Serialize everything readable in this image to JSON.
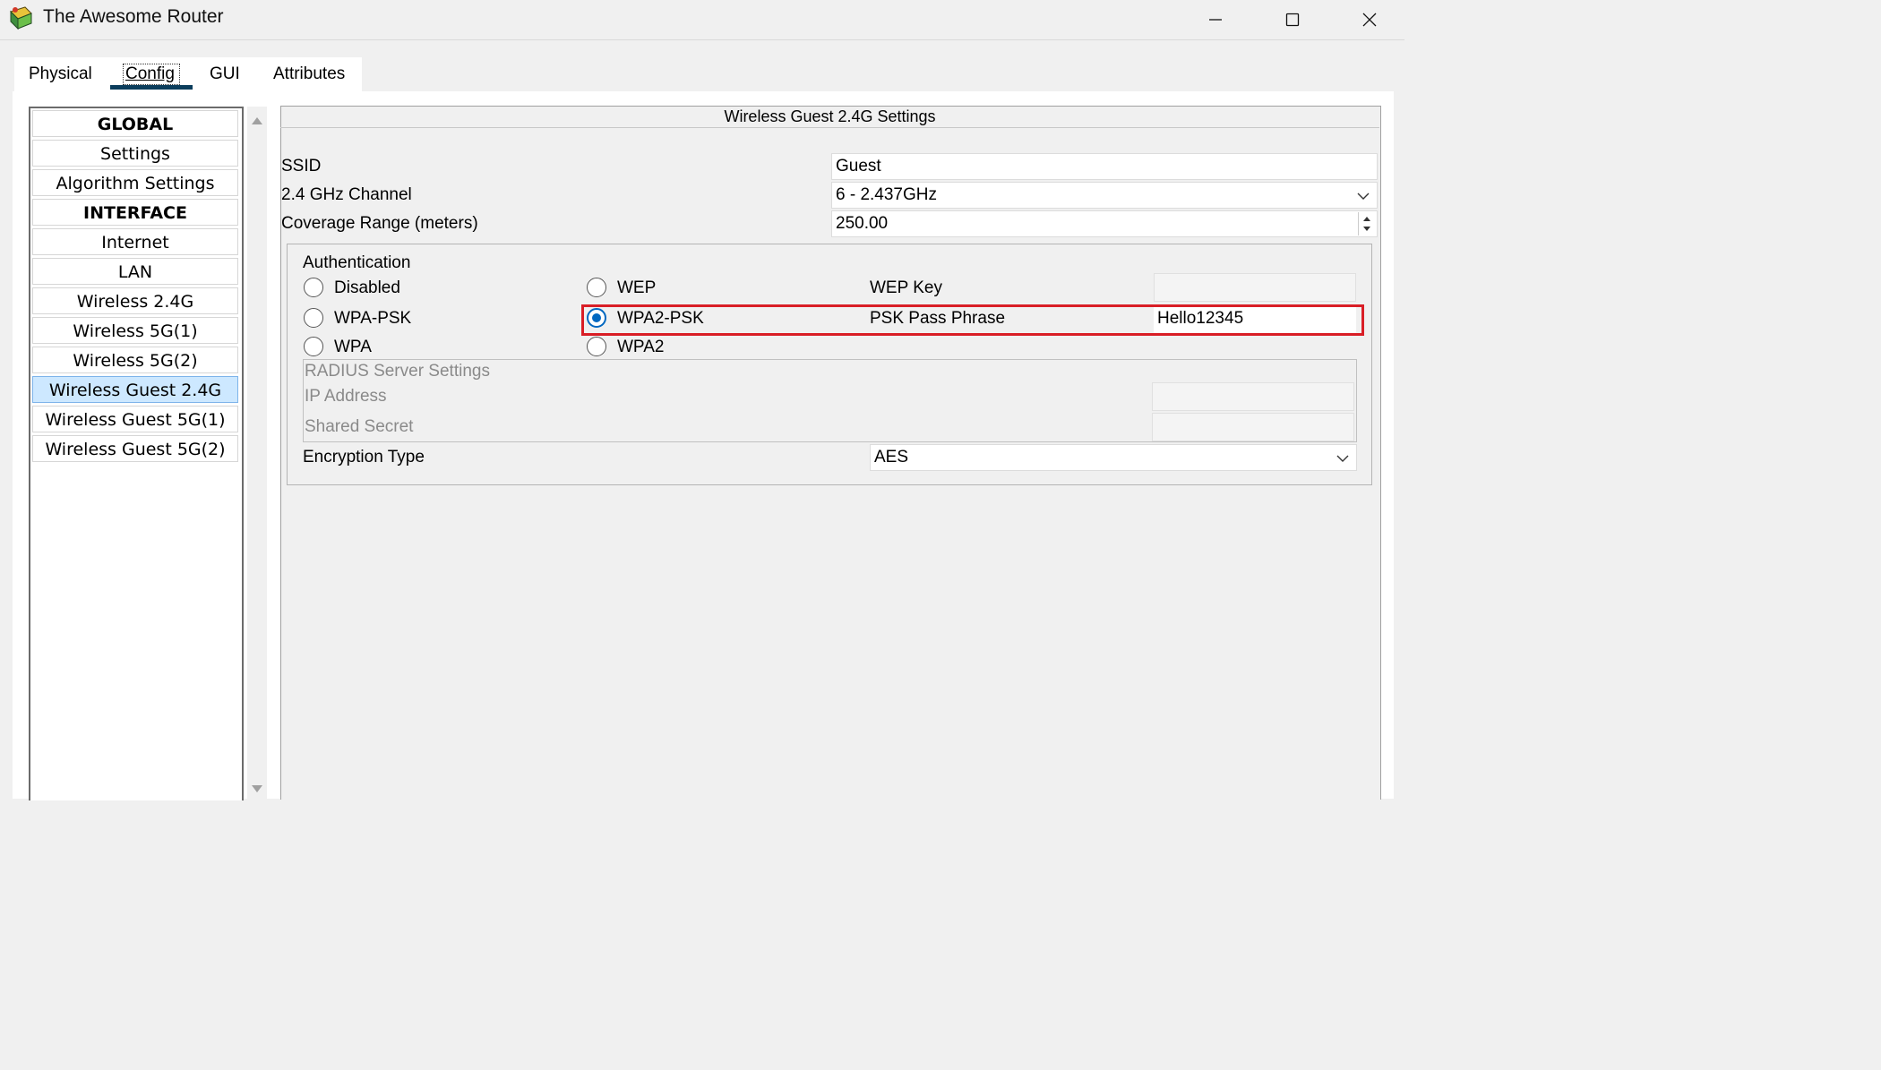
{
  "window": {
    "title": "The Awesome Router",
    "icons": {
      "app": "router-app-icon",
      "minimize": "minimize-icon",
      "maximize": "maximize-icon",
      "close": "close-icon"
    }
  },
  "tabs": [
    {
      "label": "Physical",
      "active": false
    },
    {
      "label": "Config",
      "active": true
    },
    {
      "label": "GUI",
      "active": false
    },
    {
      "label": "Attributes",
      "active": false
    }
  ],
  "sidebar": {
    "items": [
      {
        "label": "GLOBAL",
        "header": true
      },
      {
        "label": "Settings"
      },
      {
        "label": "Algorithm Settings"
      },
      {
        "label": "INTERFACE",
        "header": true
      },
      {
        "label": "Internet"
      },
      {
        "label": "LAN"
      },
      {
        "label": "Wireless 2.4G"
      },
      {
        "label": "Wireless 5G(1)"
      },
      {
        "label": "Wireless 5G(2)"
      },
      {
        "label": "Wireless Guest 2.4G",
        "selected": true
      },
      {
        "label": "Wireless Guest 5G(1)"
      },
      {
        "label": "Wireless Guest 5G(2)"
      }
    ]
  },
  "settings": {
    "title": "Wireless Guest 2.4G Settings",
    "ssid": {
      "label": "SSID",
      "value": "Guest"
    },
    "channel": {
      "label": "2.4 GHz Channel",
      "value": "6 - 2.437GHz"
    },
    "coverage": {
      "label": "Coverage Range (meters)",
      "value": "250.00"
    },
    "authentication": {
      "label": "Authentication",
      "options": [
        "Disabled",
        "WEP",
        "WPA-PSK",
        "WPA2-PSK",
        "WPA",
        "WPA2"
      ],
      "selected": "WPA2-PSK",
      "wep_key_label": "WEP Key",
      "wep_key_value": "",
      "psk_label": "PSK Pass Phrase",
      "psk_value": "Hello12345"
    },
    "radius": {
      "title": "RADIUS Server Settings",
      "ip_label": "IP Address",
      "secret_label": "Shared Secret"
    },
    "encryption": {
      "label": "Encryption Type",
      "value": "AES"
    }
  },
  "colors": {
    "selection": "#cde8ff",
    "accent": "#0067c0",
    "highlight": "#d91e26",
    "tab_underline": "#0b3d5c"
  }
}
